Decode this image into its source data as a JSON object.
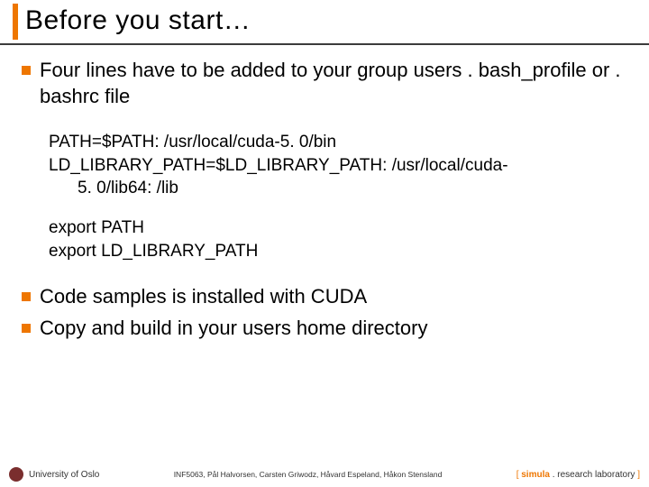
{
  "title": "Before you start…",
  "bullets": [
    "Four lines have to be added to your group users . bash_profile or . bashrc file",
    "Code samples is installed with CUDA",
    "Copy and build in your users home directory"
  ],
  "code": [
    "PATH=$PATH: /usr/local/cuda-5. 0/bin",
    "LD_LIBRARY_PATH=$LD_LIBRARY_PATH: /usr/local/cuda-",
    "5. 0/lib64: /lib",
    "export PATH",
    "export LD_LIBRARY_PATH"
  ],
  "footer": {
    "left": "University of Oslo",
    "center": "INF5063, Pål Halvorsen, Carsten Griwodz, Håvard Espeland, Håkon Stensland",
    "right": {
      "brand": "simula",
      "rest": " . research laboratory"
    }
  }
}
